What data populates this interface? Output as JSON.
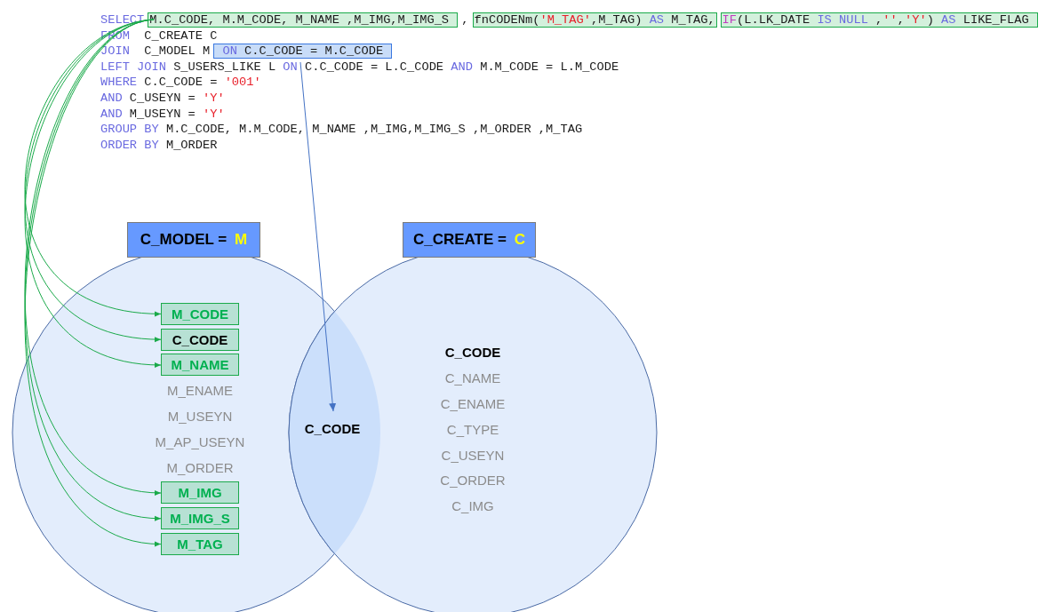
{
  "code_lines": [
    {
      "segments": [
        {
          "kind": "text",
          "tokens": [
            {
              "text": "SELECT",
              "kind": "kw"
            }
          ]
        },
        {
          "kind": "green-highlight",
          "tokens": [
            {
              "text": "M.C_CODE, M.M_CODE, M_NAME ,M_IMG,M_IMG_S ",
              "kind": "id"
            }
          ]
        },
        {
          "kind": "text",
          "tokens": [
            {
              "text": ",",
              "kind": "id"
            }
          ]
        },
        {
          "kind": "green-highlight",
          "tokens": [
            {
              "text": "fnCODENm(",
              "kind": "id"
            },
            {
              "text": "'M_TAG'",
              "kind": "str"
            },
            {
              "text": ",M_TAG) ",
              "kind": "id"
            },
            {
              "text": "AS",
              "kind": "kw"
            },
            {
              "text": " M_TAG,",
              "kind": "id"
            }
          ]
        },
        {
          "kind": "green-highlight",
          "tokens": [
            {
              "text": "IF",
              "kind": "fn"
            },
            {
              "text": "(L.LK_DATE ",
              "kind": "id"
            },
            {
              "text": "IS NULL",
              "kind": "kw"
            },
            {
              "text": " ,",
              "kind": "id"
            },
            {
              "text": "''",
              "kind": "str"
            },
            {
              "text": ",",
              "kind": "id"
            },
            {
              "text": "'Y'",
              "kind": "str"
            },
            {
              "text": ") ",
              "kind": "id"
            },
            {
              "text": "AS",
              "kind": "kw"
            },
            {
              "text": " LIKE_FLAG ",
              "kind": "id"
            }
          ]
        }
      ]
    },
    {
      "segments": [
        {
          "kind": "text",
          "tokens": [
            {
              "text": "FROM",
              "kind": "kw"
            },
            {
              "text": "  C_CREATE C",
              "kind": "id"
            }
          ]
        }
      ]
    },
    {
      "segments": [
        {
          "kind": "text",
          "tokens": [
            {
              "text": "JOIN",
              "kind": "kw"
            },
            {
              "text": "  C_MODEL M",
              "kind": "id"
            }
          ]
        },
        {
          "kind": "blue-highlight",
          "tokens": [
            {
              "text": " ON",
              "kind": "kw"
            },
            {
              "text": " C.C_CODE = M.C_CODE ",
              "kind": "id"
            }
          ]
        }
      ]
    },
    {
      "segments": [
        {
          "kind": "text",
          "tokens": [
            {
              "text": "LEFT JOIN",
              "kind": "kw"
            },
            {
              "text": " S_USERS_LIKE L ",
              "kind": "id"
            },
            {
              "text": "ON",
              "kind": "kw"
            },
            {
              "text": " C.C_CODE = L.C_CODE ",
              "kind": "id"
            },
            {
              "text": "AND",
              "kind": "kw"
            },
            {
              "text": " M.M_CODE = L.M_CODE",
              "kind": "id"
            }
          ]
        }
      ]
    },
    {
      "segments": [
        {
          "kind": "text",
          "tokens": [
            {
              "text": "WHERE",
              "kind": "kw"
            },
            {
              "text": " C.C_CODE = ",
              "kind": "id"
            },
            {
              "text": "'001'",
              "kind": "str"
            }
          ]
        }
      ]
    },
    {
      "segments": [
        {
          "kind": "text",
          "tokens": [
            {
              "text": "AND",
              "kind": "kw"
            },
            {
              "text": " C_USEYN = ",
              "kind": "id"
            },
            {
              "text": "'Y'",
              "kind": "str"
            }
          ]
        }
      ]
    },
    {
      "segments": [
        {
          "kind": "text",
          "tokens": [
            {
              "text": "AND",
              "kind": "kw"
            },
            {
              "text": " M_USEYN = ",
              "kind": "id"
            },
            {
              "text": "'Y'",
              "kind": "str"
            }
          ]
        }
      ]
    },
    {
      "segments": [
        {
          "kind": "text",
          "tokens": [
            {
              "text": "GROUP BY",
              "kind": "kw"
            },
            {
              "text": " M.C_CODE, M.M_CODE, M_NAME ,M_IMG,M_IMG_S ,M_ORDER ,M_TAG",
              "kind": "id"
            }
          ]
        }
      ]
    },
    {
      "segments": [
        {
          "kind": "text",
          "tokens": [
            {
              "text": "ORDER BY",
              "kind": "kw"
            },
            {
              "text": " M_ORDER",
              "kind": "id"
            }
          ]
        }
      ]
    }
  ],
  "sets": [
    {
      "title": "C_MODEL =",
      "alias": "M",
      "fields": [
        {
          "text": "M_CODE",
          "kind": "selected"
        },
        {
          "text": "C_CODE",
          "kind": "key-selected"
        },
        {
          "text": "M_NAME",
          "kind": "selected"
        },
        {
          "text": "M_ENAME",
          "kind": "column"
        },
        {
          "text": "M_USEYN",
          "kind": "column"
        },
        {
          "text": "M_AP_USEYN",
          "kind": "column"
        },
        {
          "text": "M_ORDER",
          "kind": "column"
        },
        {
          "text": "M_IMG",
          "kind": "selected"
        },
        {
          "text": "M_IMG_S",
          "kind": "selected"
        },
        {
          "text": "M_TAG",
          "kind": "selected"
        }
      ]
    },
    {
      "title": "C_CREATE =",
      "alias": "C",
      "fields": [
        {
          "text": "C_CODE",
          "kind": "key"
        },
        {
          "text": "C_NAME",
          "kind": "column"
        },
        {
          "text": "C_ENAME",
          "kind": "column"
        },
        {
          "text": "C_TYPE",
          "kind": "column"
        },
        {
          "text": "C_USEYN",
          "kind": "column"
        },
        {
          "text": "C_ORDER",
          "kind": "column"
        },
        {
          "text": "C_IMG",
          "kind": "column"
        }
      ]
    }
  ],
  "overlap": {
    "text": "C_CODE"
  }
}
